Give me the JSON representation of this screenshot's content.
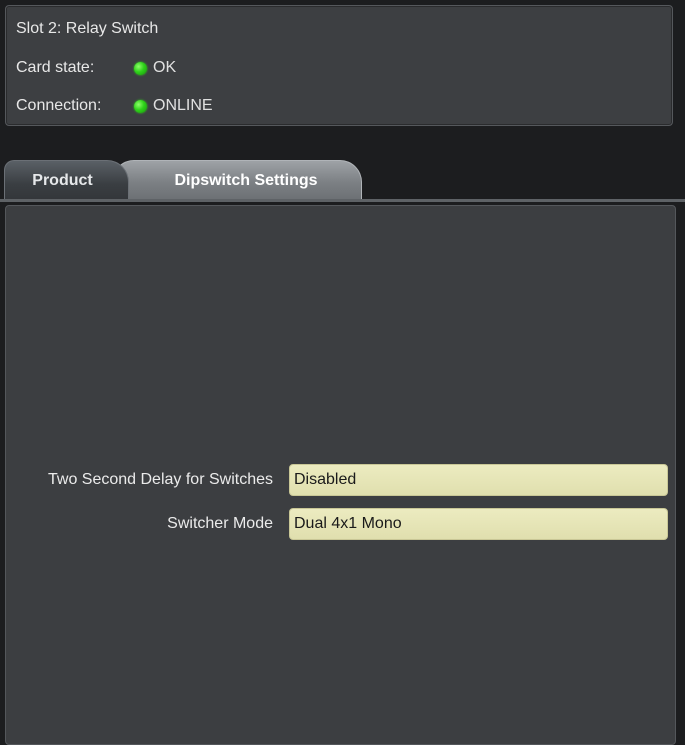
{
  "status": {
    "slot_title": "Slot 2: Relay Switch",
    "card_state_label": "Card state:",
    "card_state_value": "OK",
    "card_state_color": "#2fd21a",
    "connection_label": "Connection:",
    "connection_value": "ONLINE",
    "connection_color": "#2fd21a"
  },
  "tabs": [
    {
      "label": "Product",
      "active": false
    },
    {
      "label": "Dipswitch Settings",
      "active": true
    }
  ],
  "settings": [
    {
      "label": "Two Second Delay for Switches",
      "value": "Disabled"
    },
    {
      "label": "Switcher Mode",
      "value": "Dual 4x1 Mono"
    }
  ],
  "colors": {
    "field_bg": "#e6e5b6",
    "panel_bg": "#3c3e41",
    "background": "#1c1d1f"
  }
}
